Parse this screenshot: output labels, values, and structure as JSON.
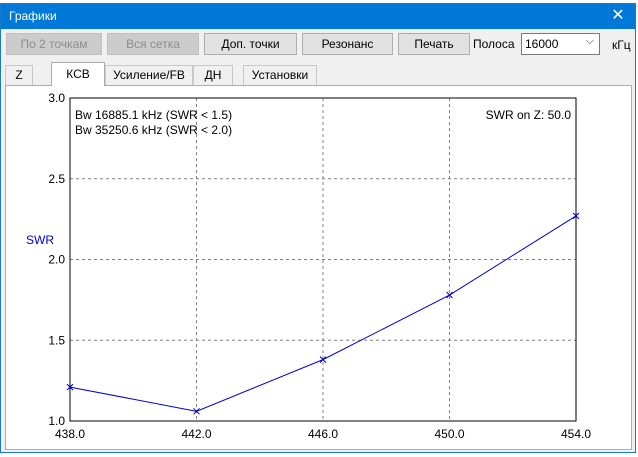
{
  "window": {
    "title": "Графики",
    "close_glyph": "✕"
  },
  "toolbar": {
    "btn_two_points": "По 2 точкам",
    "btn_full_grid": "Вся сетка",
    "btn_extra_points": "Доп. точки",
    "btn_resonance": "Резонанс",
    "btn_print": "Печать",
    "band_label": "Полоса",
    "band_value": "16000",
    "unit": "кГц"
  },
  "tabs": [
    {
      "label": "Z",
      "active": false
    },
    {
      "label": "КСВ",
      "active": true
    },
    {
      "label": "Усиление/FB",
      "active": false
    },
    {
      "label": "ДН",
      "active": false
    },
    {
      "label": "Установки",
      "active": false
    }
  ],
  "chart_data": {
    "type": "line",
    "ylabel": "SWR",
    "xlabel": "",
    "xlim": [
      438.0,
      454.0
    ],
    "ylim": [
      1.0,
      3.0
    ],
    "x_ticks": [
      "438.0",
      "442.0",
      "446.0",
      "450.0",
      "454.0"
    ],
    "y_ticks": [
      "1.0",
      "1.5",
      "2.0",
      "2.5",
      "3.0"
    ],
    "grid": true,
    "marker": "x",
    "line_color": "#0000cc",
    "annotations": [
      "Bw 16885.1 kHz (SWR < 1.5)",
      "Bw 35250.6 kHz (SWR < 2.0)"
    ],
    "note_right": "SWR on Z: 50.0",
    "series": [
      {
        "x": [
          438.0,
          442.0,
          446.0,
          450.0,
          454.0
        ],
        "y": [
          1.21,
          1.06,
          1.38,
          1.78,
          2.27
        ]
      }
    ]
  }
}
